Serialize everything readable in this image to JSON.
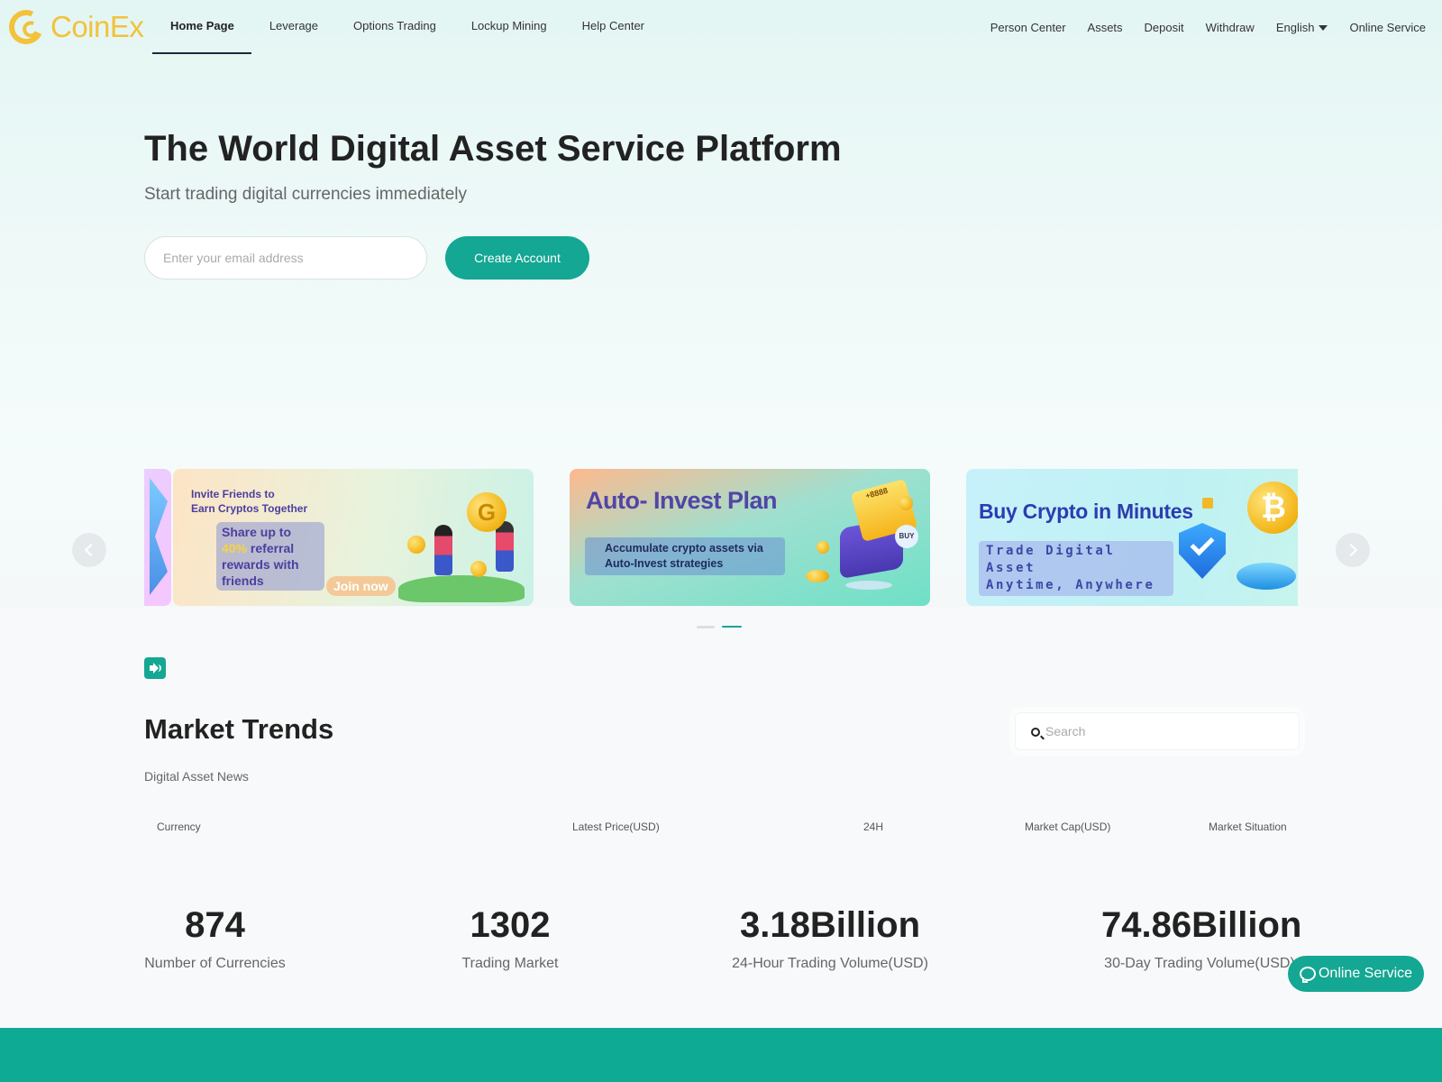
{
  "brand": {
    "name": "CoinEx",
    "color": "#f2c23a"
  },
  "accent_color": "#14a793",
  "nav": {
    "left": [
      {
        "label": "Home Page",
        "active": true
      },
      {
        "label": "Leverage"
      },
      {
        "label": "Options Trading"
      },
      {
        "label": "Lockup Mining"
      },
      {
        "label": "Help Center"
      }
    ],
    "right": {
      "person_center": "Person Center",
      "assets": "Assets",
      "deposit": "Deposit",
      "withdraw": "Withdraw",
      "language": "English",
      "online_service": "Online Service"
    }
  },
  "hero": {
    "title": "The World Digital Asset Service Platform",
    "subtitle": "Start trading digital currencies immediately",
    "email_placeholder": "Enter your email address",
    "create_account": "Create Account"
  },
  "banners": [
    {
      "title_line1": "Invite Friends to",
      "title_line2": "Earn Cryptos Together",
      "box_pre": "Share up to ",
      "box_highlight": "40%",
      "box_post": "referral rewards with friends",
      "cta": "Join now",
      "coin_letter": "G"
    },
    {
      "title": "Auto- Invest Plan",
      "box_text": "Accumulate crypto assets via Auto-Invest strategies",
      "card_text": "+8888",
      "badge": "BUY"
    },
    {
      "title": "Buy Crypto in Minutes",
      "box_line1": "Trade Digital Asset",
      "box_line2": "Anytime, Anywhere",
      "coin_symbol": "₿"
    }
  ],
  "carousel": {
    "active_dot": 1,
    "dot_count": 2
  },
  "market": {
    "title": "Market Trends",
    "subtitle": "Digital Asset News",
    "search_placeholder": "Search",
    "columns": [
      "Currency",
      "Latest Price(USD)",
      "24H",
      "Market Cap(USD)",
      "Market Situation"
    ]
  },
  "stats": [
    {
      "value": "874",
      "label": "Number of Currencies"
    },
    {
      "value": "1302",
      "label": "Trading Market"
    },
    {
      "value": "3.18Billion",
      "label": "24-Hour Trading Volume(USD)"
    },
    {
      "value": "74.86Billion",
      "label": "30-Day Trading Volume(USD)"
    }
  ],
  "float_service": {
    "label": "Online Service"
  },
  "icons": [
    "logo-mark",
    "caret-down",
    "chevron-left",
    "chevron-right",
    "speaker",
    "search",
    "chat"
  ]
}
